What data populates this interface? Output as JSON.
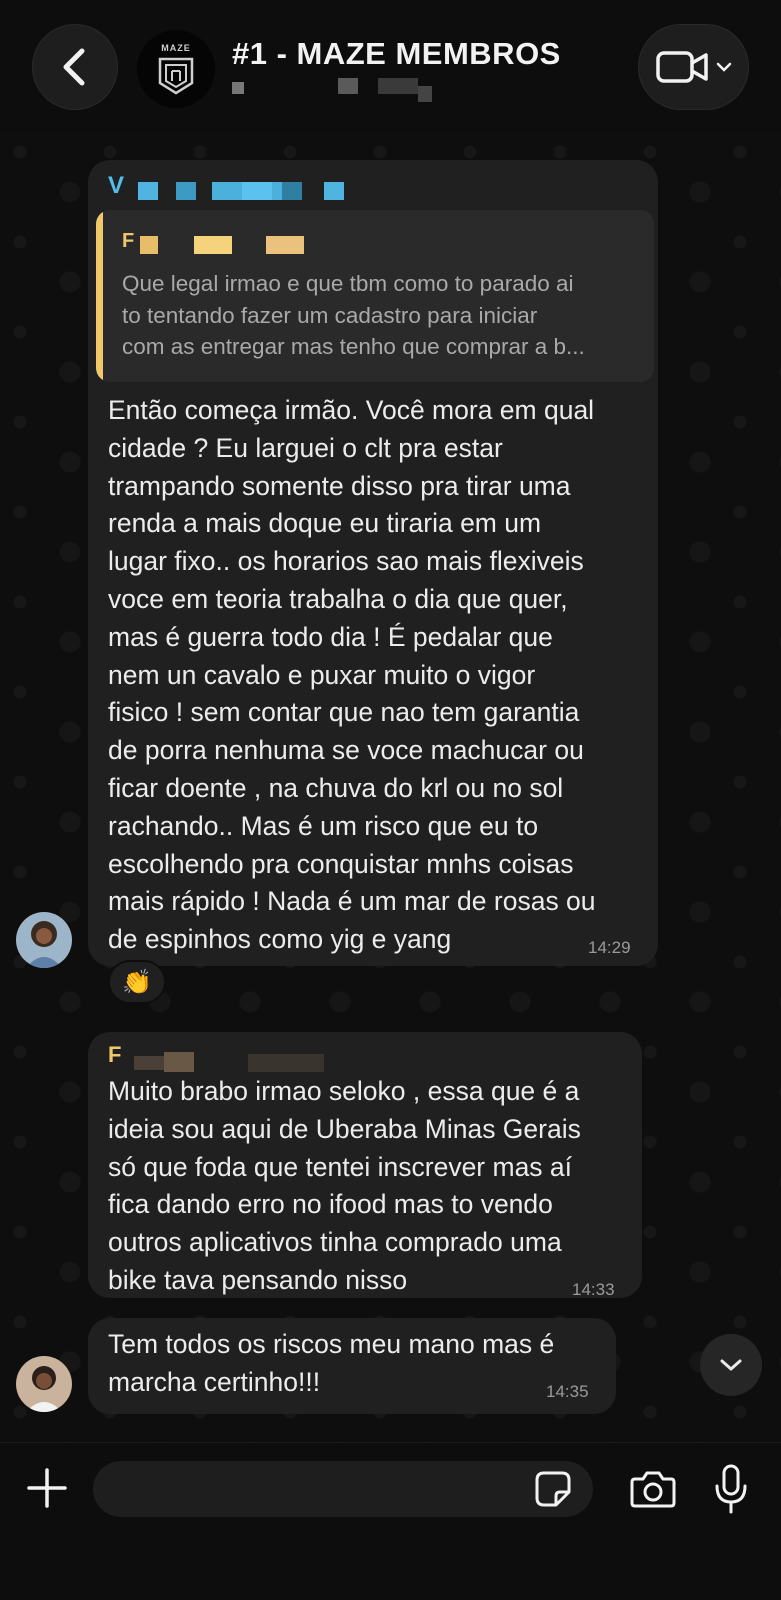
{
  "header": {
    "title": "#1 - MAZE MEMBROS",
    "avatar_text": "MAZE"
  },
  "messages": [
    {
      "sender_initial": "V",
      "quote": {
        "sender_initial": "F",
        "text": "Que legal irmao e que tbm como to parado ai\nto tentando fazer um cadastro para iniciar\ncom as entregar mas tenho que comprar a b..."
      },
      "text": "Então começa irmão. Você mora em qual\ncidade ? Eu larguei o clt pra estar\ntrampando somente disso pra tirar uma\nrenda a mais doque eu tiraria em um\nlugar fixo.. os horarios sao mais flexiveis\nvoce em teoria trabalha o dia que quer,\nmas é guerra todo dia ! É pedalar que\nnem un cavalo e puxar muito o vigor\nfisico ! sem contar que nao tem garantia\nde porra nenhuma se voce machucar ou\nficar doente , na chuva do krl ou no sol\nrachando.. Mas é um risco que eu to\nescolhendo pra conquistar mnhs coisas\nmais rápido ! Nada é um mar de rosas ou\nde espinhos como yig e yang",
      "time": "14:29",
      "reaction": "👏"
    },
    {
      "sender_initial": "F",
      "text": "Muito brabo irmao seloko , essa que é a\nideia sou aqui de Uberaba Minas Gerais\nsó que foda que tentei inscrever mas aí\nfica dando erro no ifood mas to vendo\noutros aplicativos tinha comprado uma\nbike tava pensando nisso",
      "time": "14:33"
    },
    {
      "text": "Tem todos os riscos meu mano mas é\nmarcha certinho!!!",
      "time": "14:35"
    }
  ],
  "composer": {
    "value": "",
    "placeholder": ""
  },
  "colors": {
    "background": "#0e0e0e",
    "bubble": "#202020",
    "quote_accent": "#f0c76a",
    "sender_v": "#53bdeb",
    "sender_f": "#f0c76a",
    "time": "#9a9a9a"
  },
  "icons": [
    "back-icon",
    "video-call-icon",
    "chevron-down-icon",
    "plus-icon",
    "sticker-icon",
    "camera-icon",
    "microphone-icon",
    "scroll-down-icon"
  ]
}
